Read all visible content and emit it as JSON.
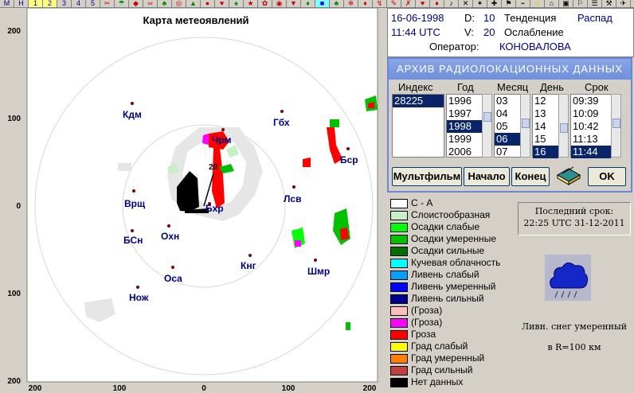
{
  "toolbar": {
    "items": [
      "M",
      "H",
      "1",
      "2",
      "3",
      "4",
      "5"
    ]
  },
  "map": {
    "title": "Карта метеоявлений",
    "axis_left": [
      "200",
      "100",
      "0",
      "100",
      "200"
    ],
    "axis_bottom": [
      "200",
      "100",
      "0",
      "100",
      "200"
    ],
    "range_label": "20",
    "cities": [
      {
        "name": "Кдм"
      },
      {
        "name": "Гбх"
      },
      {
        "name": "Чрм"
      },
      {
        "name": "Бср"
      },
      {
        "name": "Врщ"
      },
      {
        "name": "Лсв"
      },
      {
        "name": "Охн"
      },
      {
        "name": "БСн"
      },
      {
        "name": "Бхр"
      },
      {
        "name": "Кнг"
      },
      {
        "name": "Шмр"
      },
      {
        "name": "Оса"
      },
      {
        "name": "Нож"
      }
    ]
  },
  "info": {
    "date": "16-06-1998",
    "d_label": "D:",
    "d_value": "10",
    "tendency_label": "Тенденция",
    "tendency_value": "Распад",
    "time": "11:44  UTC",
    "v_label": "V:",
    "v_value": "20",
    "weakening_label": "Ослабление",
    "operator_label": "Оператор:",
    "operator_value": "КОНОВАЛОВА"
  },
  "archive": {
    "title": "АРХИВ  РАДИОЛОКАЦИОННЫХ  ДАННЫХ",
    "headers": {
      "index": "Индекс",
      "year": "Год",
      "month": "Месяц",
      "day": "День",
      "term": "Срок"
    },
    "index_items": [
      "28225"
    ],
    "years": [
      "1996",
      "1997",
      "1998",
      "1999",
      "2006"
    ],
    "months": [
      "03",
      "04",
      "05",
      "06",
      "07"
    ],
    "days": [
      "12",
      "13",
      "14",
      "15",
      "16"
    ],
    "terms": [
      "09:39",
      "10:09",
      "10:42",
      "11:13",
      "11:44"
    ],
    "selected": {
      "year": "1998",
      "month": "06",
      "day": "16",
      "term": "11:44",
      "index": "28225"
    },
    "buttons": {
      "multi": "Мультфильм",
      "start": "Начало",
      "end": "Конец",
      "ok": "OK"
    }
  },
  "legend": [
    {
      "label": "С - А",
      "color": "#ffffff"
    },
    {
      "label": "Слоистообразная",
      "color": "#c8f0c8"
    },
    {
      "label": "Осадки слабые",
      "color": "#00ff00"
    },
    {
      "label": "Осадки умеренные",
      "color": "#00c000"
    },
    {
      "label": "Осадки сильные",
      "color": "#007000"
    },
    {
      "label": "Кучевая облачность",
      "color": "#00ffff"
    },
    {
      "label": "Ливень слабый",
      "color": "#00a0ff"
    },
    {
      "label": "Ливень умеренный",
      "color": "#0000ff"
    },
    {
      "label": "Ливень сильный",
      "color": "#000090"
    },
    {
      "label": "(Гроза)",
      "color": "#ffc0c0"
    },
    {
      "label": "(Гроза)",
      "color": "#ff00ff"
    },
    {
      "label": "Гроза",
      "color": "#ff0000"
    },
    {
      "label": "Град слабый",
      "color": "#ffff00"
    },
    {
      "label": "Град умеренный",
      "color": "#ff8000"
    },
    {
      "label": "Град сильный",
      "color": "#c04040"
    },
    {
      "label": "Нет данных",
      "color": "#000000"
    }
  ],
  "last_term": {
    "label": "Последний срок:",
    "value": "22:25 UTC 31-12-2011"
  },
  "forecast": {
    "icon": "rain-cloud-icon",
    "text_line1": "Ливн. снег умеренный",
    "text_line2": "в R=100 км"
  }
}
